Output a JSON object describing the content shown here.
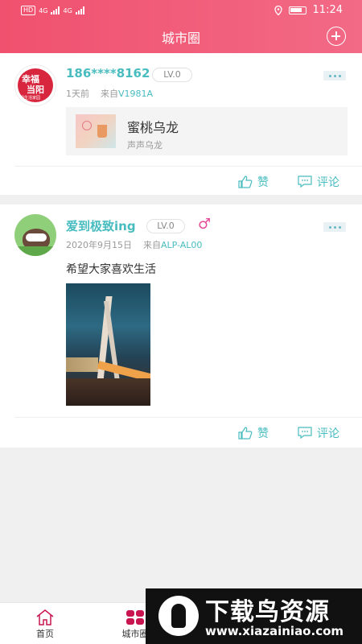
{
  "status_bar": {
    "network_badge": "HD",
    "signal_1": "4G",
    "signal_2": "4G",
    "time": "11:24"
  },
  "header": {
    "title": "城市圈"
  },
  "posts": [
    {
      "username": "186****8162",
      "level": "LV.0",
      "time": "1天前",
      "from_label": "来自",
      "device": "V1981A",
      "avatar_text": [
        "幸福",
        "当阳",
        "唱生活家园"
      ],
      "music": {
        "title": "蜜桃乌龙",
        "artist": "声声乌龙"
      },
      "like_label": "赞",
      "comment_label": "评论"
    },
    {
      "username": "爱到极致ing",
      "level": "LV.0",
      "gender_symbol": "♂",
      "time": "2020年9月15日",
      "from_label": "来自",
      "device": "ALP-AL00",
      "text": "希望大家喜欢生活",
      "like_label": "赞",
      "comment_label": "评论"
    }
  ],
  "tabbar": {
    "items": [
      {
        "label": "首页"
      },
      {
        "label": "城市圈"
      }
    ]
  },
  "watermark": {
    "title": "下载鸟资源",
    "url": "www.xiazainiao.com"
  },
  "colors": {
    "header": "#f0516e",
    "accent": "#49bcc0",
    "tab_active": "#c8154f"
  }
}
